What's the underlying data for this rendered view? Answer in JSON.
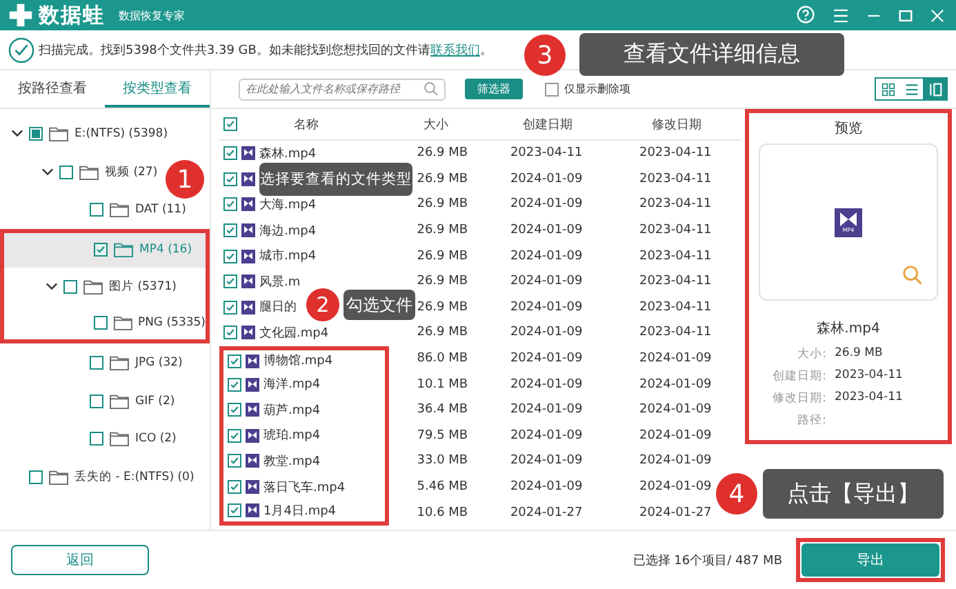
{
  "app": {
    "name": "数据蛙",
    "subtitle": "数据恢复专家"
  },
  "status": {
    "text": "扫描完成。找到5398个文件共3.39 GB。如未能找到您想找回的文件请",
    "link": "联系我们",
    "end": "。"
  },
  "view_tabs": [
    {
      "label": "按路径查看",
      "selected": false
    },
    {
      "label": "按类型查看",
      "selected": true
    }
  ],
  "tree": [
    {
      "label": "E:(NTFS) (5398)",
      "checked": false,
      "partial": true,
      "expanded": true,
      "selected": false,
      "highlighted": false,
      "children": [
        {
          "label": "视频 (27)",
          "checked": false,
          "partial": false,
          "expanded": true,
          "selected": false,
          "highlighted": false,
          "children": [
            {
              "label": "DAT (11)",
              "checked": false,
              "partial": false,
              "selected": false,
              "highlighted": false
            },
            {
              "label": "MP4 (16)",
              "checked": true,
              "partial": false,
              "selected": true,
              "highlighted": true
            }
          ]
        },
        {
          "label": "图片 (5371)",
          "checked": false,
          "partial": false,
          "expanded": true,
          "selected": false,
          "highlighted": true,
          "children": [
            {
              "label": "PNG (5335)",
              "checked": false,
              "partial": false,
              "selected": false,
              "highlighted": true
            },
            {
              "label": "JPG (32)",
              "checked": false,
              "partial": false,
              "selected": false,
              "highlighted": false
            },
            {
              "label": "GIF (2)",
              "checked": false,
              "partial": false,
              "selected": false,
              "highlighted": false
            },
            {
              "label": "ICO (2)",
              "checked": false,
              "partial": false,
              "selected": false,
              "highlighted": false
            }
          ]
        }
      ]
    },
    {
      "label": "丢失的 - E:(NTFS) (0)",
      "checked": false,
      "partial": false,
      "selected": false,
      "highlighted": false
    }
  ],
  "search": {
    "placeholder": "在此处输入文件名称或保存路径"
  },
  "filter_button": "筛选器",
  "deleted_only": {
    "label": "仅显示删除项",
    "checked": false
  },
  "view_modes": [
    {
      "kind": "grid",
      "selected": false
    },
    {
      "kind": "list",
      "selected": false
    },
    {
      "kind": "detail",
      "selected": true
    }
  ],
  "columns": [
    "名称",
    "大小",
    "创建日期",
    "修改日期"
  ],
  "select_all_checked": true,
  "rows": [
    {
      "name": "森林.mp4",
      "size": "26.9 MB",
      "created": "2023-04-11",
      "modified": "2023-04-11",
      "checked": true,
      "highlighted": false
    },
    {
      "size": "26.9 MB",
      "created": "2024-01-09",
      "modified": "2023-04-11",
      "checked": true,
      "highlighted": false
    },
    {
      "name": "大海.mp4",
      "size": "26.9 MB",
      "created": "2024-01-09",
      "modified": "2023-04-11",
      "checked": true,
      "highlighted": false
    },
    {
      "name": "海边.mp4",
      "size": "26.9 MB",
      "created": "2024-01-09",
      "modified": "2023-04-11",
      "checked": true,
      "highlighted": false
    },
    {
      "name": "城市.mp4",
      "size": "26.9 MB",
      "created": "2024-01-09",
      "modified": "2023-04-11",
      "checked": true,
      "highlighted": false
    },
    {
      "name": "风景.m",
      "size": "26.9 MB",
      "created": "2024-01-09",
      "modified": "2023-04-11",
      "checked": true,
      "highlighted": false
    },
    {
      "name": "腿日的",
      "size": "26.9 MB",
      "created": "2024-01-09",
      "modified": "2023-04-11",
      "checked": true,
      "highlighted": false
    },
    {
      "name": "文化园.mp4",
      "size": "26.9 MB",
      "created": "2024-01-09",
      "modified": "2023-04-11",
      "checked": true,
      "highlighted": false
    },
    {
      "name": "博物馆.mp4",
      "size": "86.0 MB",
      "created": "2024-01-09",
      "modified": "2024-01-09",
      "checked": true,
      "highlighted": true
    },
    {
      "name": "海洋.mp4",
      "size": "10.1 MB",
      "created": "2024-01-09",
      "modified": "2024-01-09",
      "checked": true,
      "highlighted": true
    },
    {
      "name": "葫芦.mp4",
      "size": "36.4 MB",
      "created": "2024-01-09",
      "modified": "2024-01-09",
      "checked": true,
      "highlighted": true
    },
    {
      "name": "琥珀.mp4",
      "size": "79.5 MB",
      "created": "2024-01-09",
      "modified": "2024-01-09",
      "checked": true,
      "highlighted": true
    },
    {
      "name": "教堂.mp4",
      "size": "33.0 MB",
      "created": "2024-01-09",
      "modified": "2024-01-09",
      "checked": true,
      "highlighted": true
    },
    {
      "name": "落日飞车.mp4",
      "size": "5.46 MB",
      "created": "2024-01-09",
      "modified": "2024-01-09",
      "checked": true,
      "highlighted": true
    },
    {
      "name": "1月4日.mp4",
      "size": "10.6 MB",
      "created": "2024-01-27",
      "modified": "2024-01-27",
      "checked": true,
      "highlighted": true
    }
  ],
  "preview": {
    "title": "预览",
    "file_badge": "MP4",
    "file_name": "森林.mp4",
    "highlighted": true,
    "fields": [
      {
        "label": "大小:",
        "value": "26.9 MB"
      },
      {
        "label": "创建日期:",
        "value": "2023-04-11"
      },
      {
        "label": "修改日期:",
        "value": "2023-04-11"
      },
      {
        "label": "路径:"
      }
    ]
  },
  "footer": {
    "back": "返回",
    "selection": "已选择 16个项目/ 487 MB",
    "export": "导出",
    "export_highlighted": true
  },
  "callouts": [
    {
      "number": "1",
      "text": "选择要查看的文件类型"
    },
    {
      "number": "2",
      "text": "勾选文件"
    },
    {
      "number": "3",
      "text": "查看文件详细信息"
    },
    {
      "number": "4",
      "text": "点击【导出】"
    }
  ]
}
